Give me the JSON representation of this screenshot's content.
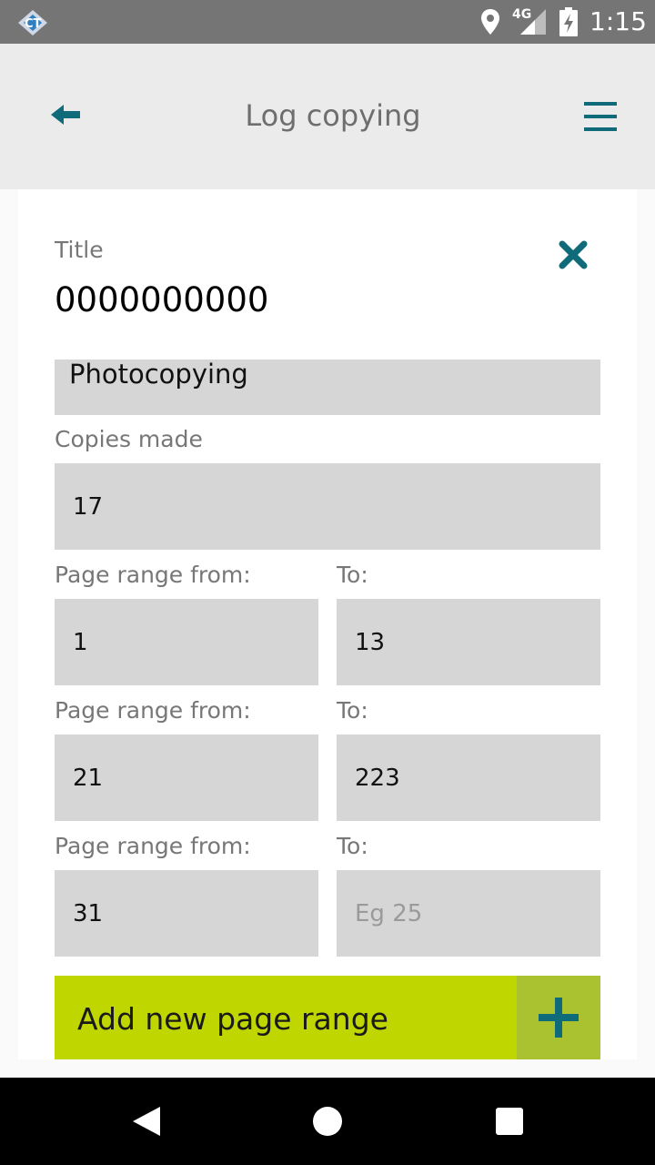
{
  "status_bar": {
    "network": "4G",
    "time": "1:15",
    "icons": [
      "app-notification-icon",
      "location-icon",
      "signal-icon",
      "battery-charging-icon"
    ]
  },
  "app_bar": {
    "title": "Log copying",
    "back_icon": "arrow-left-icon",
    "menu_icon": "hamburger-menu-icon"
  },
  "form": {
    "title_label": "Title",
    "title_value": "0000000000",
    "close_icon": "close-x-icon",
    "copy_type_value": "Photocopying",
    "copies_label": "Copies made",
    "copies_value": "17",
    "page_ranges": [
      {
        "from_label": "Page range from:",
        "to_label": "To:",
        "from_value": "1",
        "to_value": "13",
        "to_placeholder": ""
      },
      {
        "from_label": "Page range from:",
        "to_label": "To:",
        "from_value": "21",
        "to_value": "223",
        "to_placeholder": ""
      },
      {
        "from_label": "Page range from:",
        "to_label": "To:",
        "from_value": "31",
        "to_value": "",
        "to_placeholder": "Eg 25"
      }
    ],
    "add_range_label": "Add new page range",
    "add_icon": "plus-icon"
  },
  "colors": {
    "accent": "#0f6b7a",
    "button": "#bfd600",
    "button_icon_bg": "#aac130",
    "input_bg": "#d6d6d6"
  },
  "nav_bar": {
    "icons": [
      "back-triangle-icon",
      "home-circle-icon",
      "recents-square-icon"
    ]
  }
}
